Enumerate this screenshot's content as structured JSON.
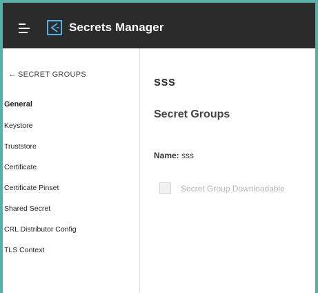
{
  "header": {
    "app_title": "Secrets Manager",
    "menu_icon": "hamburger-menu-icon",
    "logo_icon": "secrets-manager-logo-icon"
  },
  "sidebar": {
    "back_label": "SECRET GROUPS",
    "back_icon": "left-arrow-icon",
    "items": [
      {
        "label": "General",
        "active": true
      },
      {
        "label": "Keystore",
        "active": false
      },
      {
        "label": "Truststore",
        "active": false
      },
      {
        "label": "Certificate",
        "active": false
      },
      {
        "label": "Certificate Pinset",
        "active": false
      },
      {
        "label": "Shared Secret",
        "active": false
      },
      {
        "label": "CRL Distributor Config",
        "active": false
      },
      {
        "label": "TLS Context",
        "active": false
      }
    ]
  },
  "main": {
    "title": "sss",
    "section_title": "Secret Groups",
    "name_label": "Name:",
    "name_value": "sss",
    "downloadable_label": "Secret Group Downloadable",
    "downloadable_checked": false
  },
  "colors": {
    "header_bg": "#2b2b2b",
    "accent": "#4a9fd9",
    "outer_border": "#5ab0a8"
  }
}
